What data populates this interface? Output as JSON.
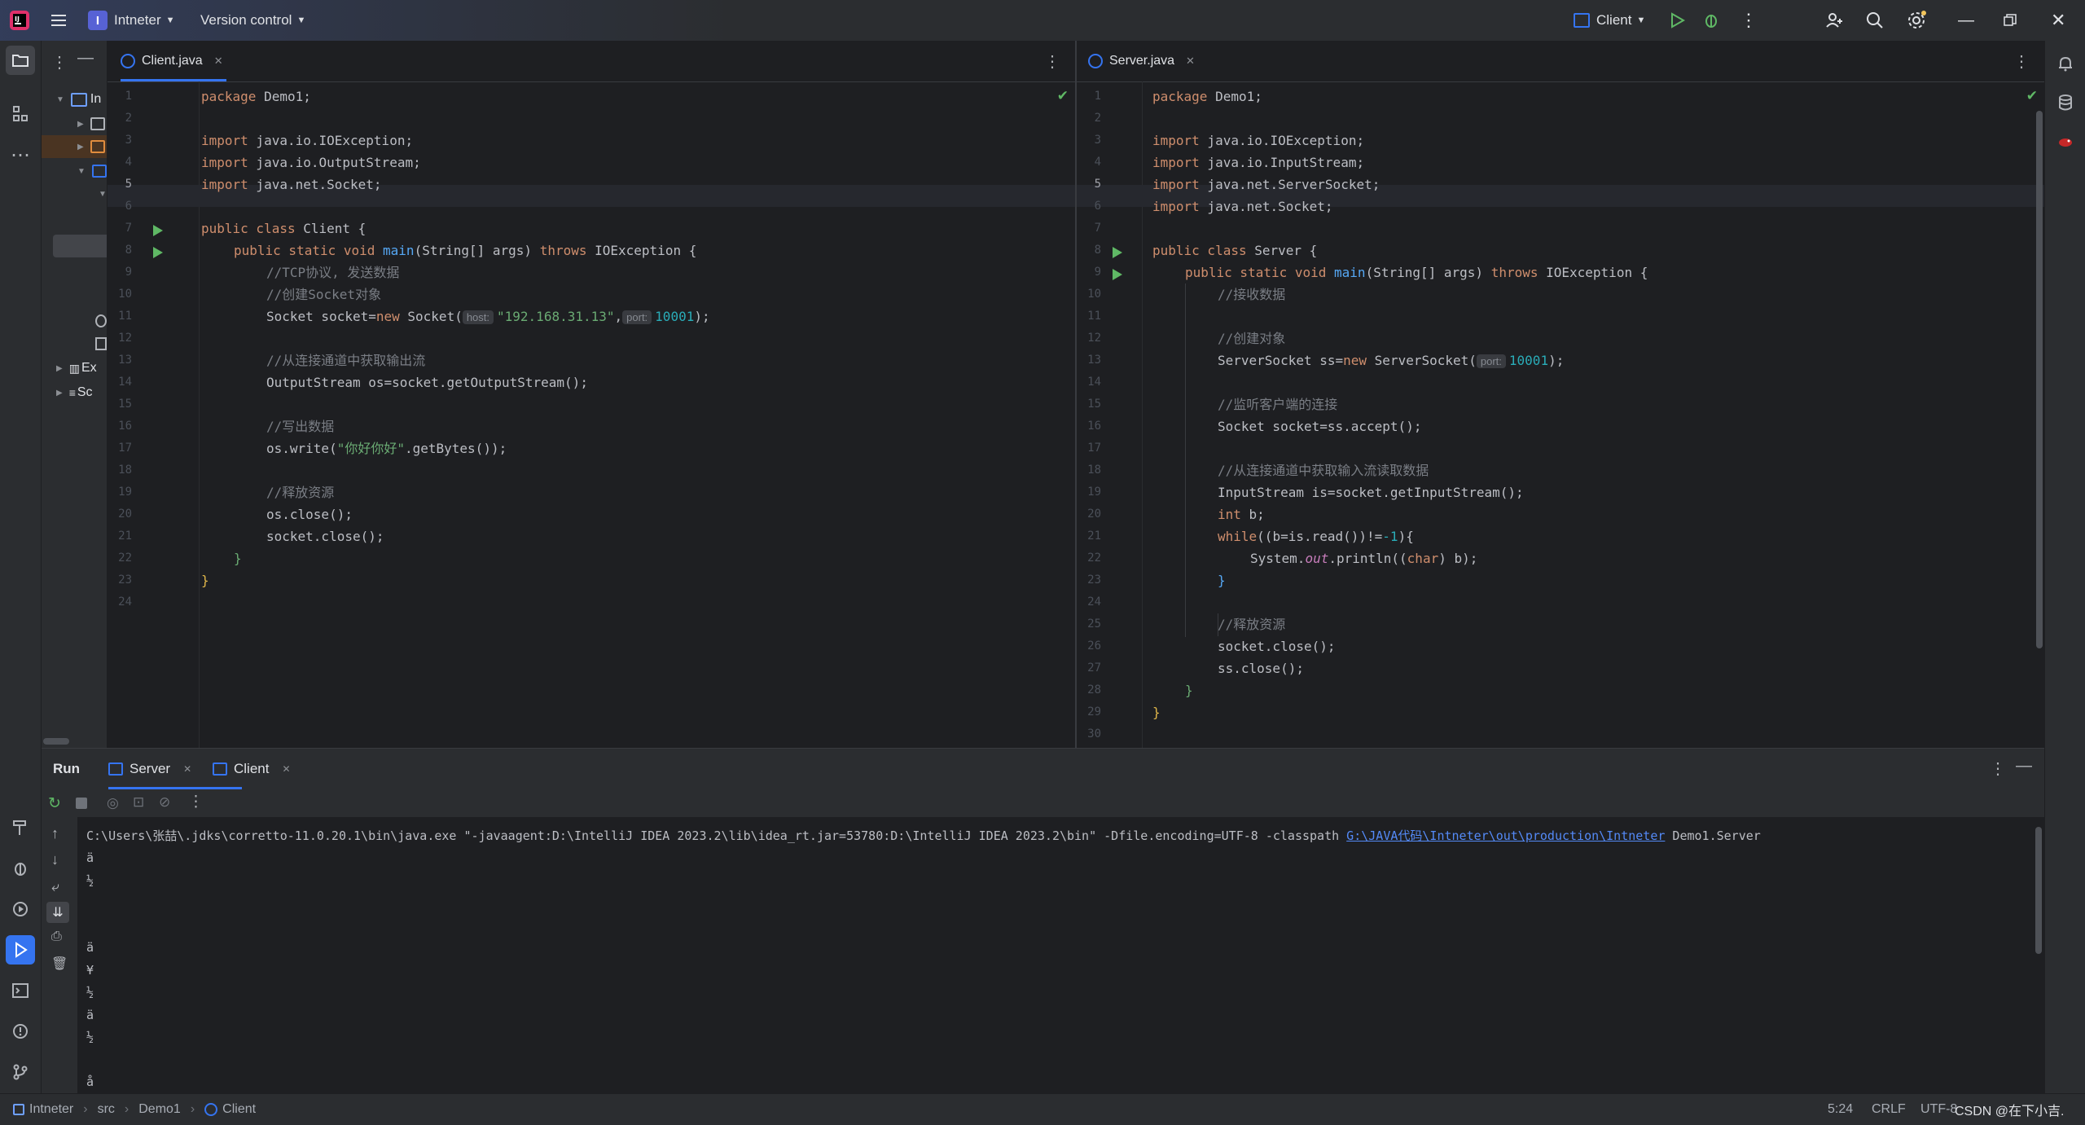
{
  "titlebar": {
    "project_badge": "I",
    "project_name": "Intneter",
    "vcs_label": "Version control",
    "run_config": "Client"
  },
  "project_tree": {
    "rows": [
      "In",
      "",
      "",
      "",
      "",
      "Ex",
      "Sc"
    ]
  },
  "left_editor": {
    "tab_label": "Client.java",
    "lines": [
      "1",
      "2",
      "3",
      "4",
      "5",
      "6",
      "7",
      "8",
      "9",
      "10",
      "11",
      "12",
      "13",
      "14",
      "15",
      "16",
      "17",
      "18",
      "19",
      "20",
      "21",
      "22",
      "23",
      "24"
    ],
    "code": {
      "l1_kw": "package",
      "l1_rest": " Demo1;",
      "l3_kw": "import",
      "l3_rest": " java.io.IOException;",
      "l4_kw": "import",
      "l4_rest": " java.io.OutputStream;",
      "l5_kw": "import",
      "l5_rest": " java.net.Socket;",
      "l7_kw": "public class",
      "l7_rest": " Client {",
      "l8_kw1": "public static void",
      "l8_fn": "main",
      "l8_mid": "(String[] args) ",
      "l8_kw2": "throws",
      "l8_rest": " IOException {",
      "l9": "//TCP协议, 发送数据",
      "l10": "//创建Socket对象",
      "l11_a": "Socket socket=",
      "l11_kw": "new",
      "l11_b": " Socket(",
      "l11_hint1": "host:",
      "l11_str": "\"192.168.31.13\"",
      "l11_c": ",",
      "l11_hint2": "port:",
      "l11_num": "10001",
      "l11_d": ");",
      "l13": "//从连接通道中获取输出流",
      "l14": "OutputStream os=socket.getOutputStream();",
      "l16": "//写出数据",
      "l17_a": "os.write(",
      "l17_str": "\"你好你好\"",
      "l17_b": ".getBytes());",
      "l19": "//释放资源",
      "l20": "os.close();",
      "l21": "socket.close();",
      "l22": "}",
      "l23": "}"
    }
  },
  "right_editor": {
    "tab_label": "Server.java",
    "lines": [
      "1",
      "2",
      "3",
      "4",
      "5",
      "6",
      "7",
      "8",
      "9",
      "10",
      "11",
      "12",
      "13",
      "14",
      "15",
      "16",
      "17",
      "18",
      "19",
      "20",
      "21",
      "22",
      "23",
      "24",
      "25",
      "26",
      "27",
      "28",
      "29",
      "30"
    ],
    "code": {
      "l1_kw": "package",
      "l1_rest": " Demo1;",
      "l3_kw": "import",
      "l3_rest": " java.io.IOException;",
      "l4_kw": "import",
      "l4_rest": " java.io.InputStream;",
      "l5_kw": "import",
      "l5_rest": " java.net.ServerSocket;",
      "l6_kw": "import",
      "l6_rest": " java.net.Socket;",
      "l8_kw": "public class",
      "l8_rest": " Server {",
      "l9_kw1": "public static void",
      "l9_fn": "main",
      "l9_mid": "(String[] args) ",
      "l9_kw2": "throws",
      "l9_rest": " IOException {",
      "l10": "//接收数据",
      "l12": "//创建对象",
      "l13_a": "ServerSocket ss=",
      "l13_kw": "new",
      "l13_b": " ServerSocket(",
      "l13_hint": "port:",
      "l13_num": "10001",
      "l13_c": ");",
      "l15": "//监听客户端的连接",
      "l16": "Socket socket=ss.accept();",
      "l18": "//从连接通道中获取输入流读取数据",
      "l19": "InputStream is=socket.getInputStream();",
      "l20_kw": "int",
      "l20_rest": " b;",
      "l21_kw": "while",
      "l21_a": "((b=is.read())!=",
      "l21_num": "-1",
      "l21_b": "){",
      "l22_a": "System.",
      "l22_fld": "out",
      "l22_b": ".println((",
      "l22_kw": "char",
      "l22_c": ") b);",
      "l23": "}",
      "l25": "//释放资源",
      "l26": "socket.close();",
      "l27": "ss.close();",
      "l28": "}",
      "l29": "}"
    }
  },
  "run_panel": {
    "title": "Run",
    "tabs": [
      "Server",
      "Client"
    ],
    "command_prefix": "C:\\Users\\张喆\\.jdks\\corretto-11.0.20.1\\bin\\java.exe \"-javaagent:D:\\IntelliJ IDEA 2023.2\\lib\\idea_rt.jar=53780:D:\\IntelliJ IDEA 2023.2\\bin\" -Dfile.encoding=UTF-8 -classpath ",
    "command_link": "G:\\JAVA代码\\Intneter\\out\\production\\Intneter",
    "command_suffix": " Demo1.Server",
    "output": [
      "ä",
      "½",
      "",
      "",
      "ä",
      "¥",
      "½",
      "ä",
      "½",
      "",
      "å",
      "¥"
    ]
  },
  "statusbar": {
    "crumbs": [
      "Intneter",
      "src",
      "Demo1",
      "Client"
    ],
    "position": "5:24",
    "line_sep": "CRLF",
    "encoding": "UTF-8",
    "watermark": "CSDN @在下小吉."
  },
  "colors": {
    "accent": "#3574f0",
    "keyword": "#cf8e6d",
    "string": "#6aab73",
    "number": "#2aacb8",
    "function": "#56a8f5",
    "comment": "#7a7e85"
  }
}
